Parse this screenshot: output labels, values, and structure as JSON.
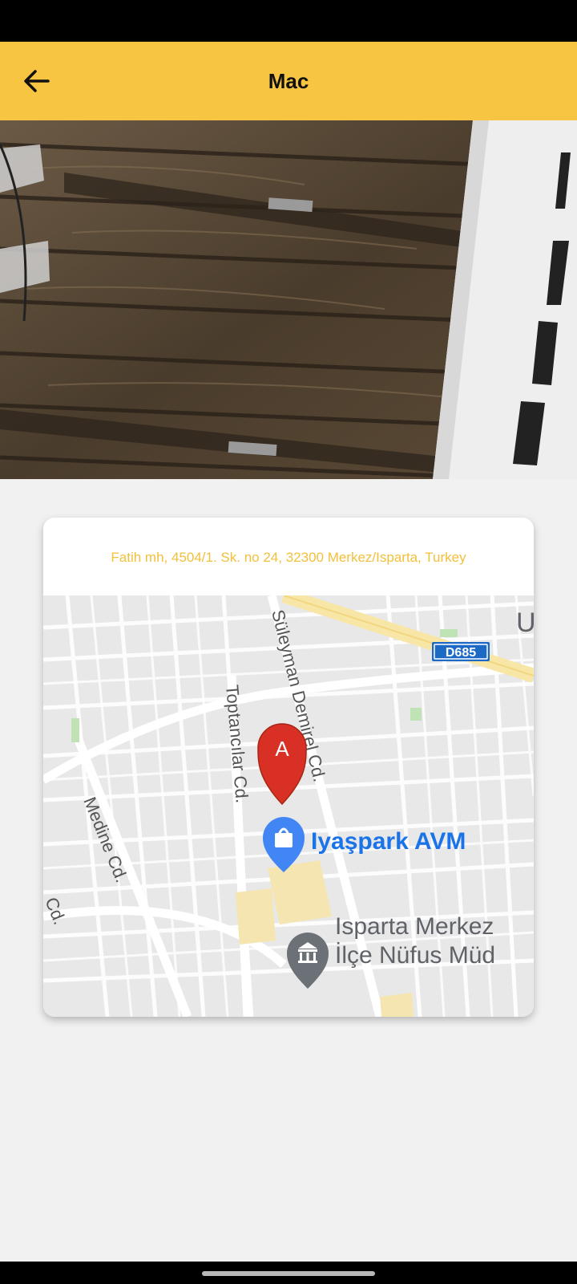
{
  "app_bar": {
    "title": "Mac",
    "back_icon": "arrow-left-icon",
    "background": "#f8c542"
  },
  "location_card": {
    "address": "Fatih mh, 4504/1. Sk. no 24, 32300 Merkez/Isparta, Turkey",
    "address_color": "#f2c03c",
    "map": {
      "marker_label": "A",
      "road_badge": "D685",
      "streets": [
        "Süleyman Demirel Cd.",
        "Toptancılar Cd.",
        "Medine Cd.",
        "Cd."
      ],
      "places": [
        {
          "name": "Iyaşpark AVM",
          "icon": "shopping-bag-icon",
          "color": "#1a73e8"
        },
        {
          "name_line1": "Isparta Merkez",
          "name_line2": "İlçe Nüfus Müd",
          "icon": "government-building-icon",
          "color": "#5f6368"
        }
      ],
      "edge_label": "U"
    }
  }
}
